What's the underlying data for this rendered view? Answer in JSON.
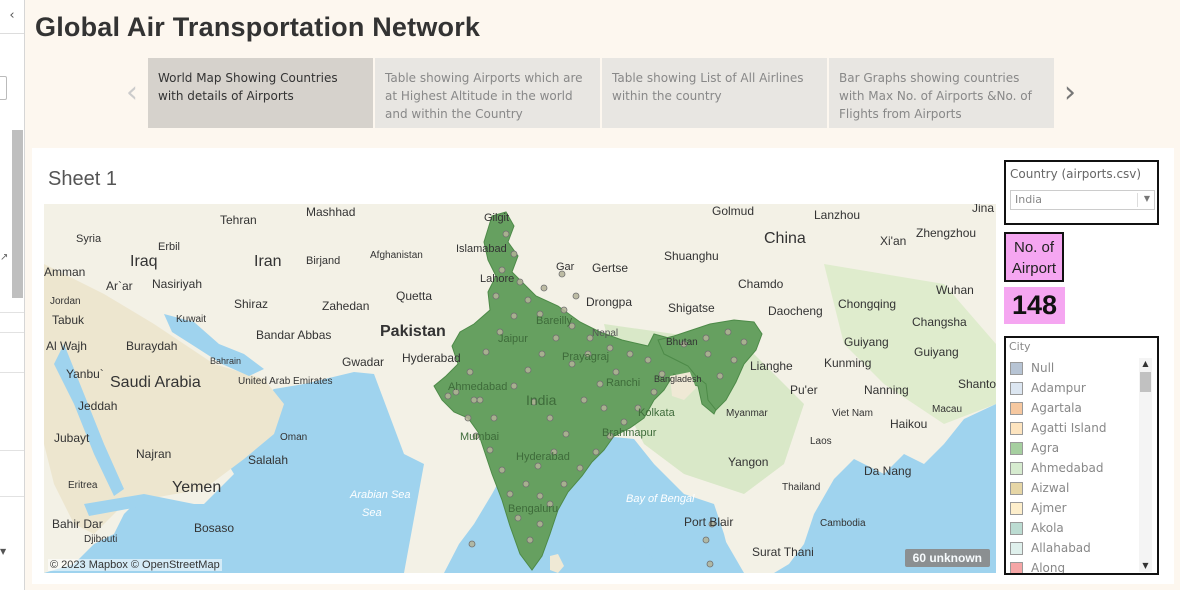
{
  "dashboard": {
    "title": "Global Air Transportation Network"
  },
  "story_points": [
    {
      "label": "World Map Showing Countries with details of Airports",
      "active": true
    },
    {
      "label": "Table showing Airports which are at Highest Altitude in the world and within the Country",
      "active": false
    },
    {
      "label": "Table showing List of All Airlines within the country",
      "active": false
    },
    {
      "label": "Bar Graphs showing countries with Max No. of Airports &No. of Flights from Airports",
      "active": false
    }
  ],
  "sheet": {
    "title": "Sheet 1"
  },
  "map": {
    "attribution": "© 2023 Mapbox © OpenStreetMap",
    "unknown_badge": "60 unknown",
    "highlight_country": "India",
    "highlight_color": "#66a060",
    "water_color": "#9fd3ee",
    "labels": {
      "country": [
        "Iraq",
        "Iran",
        "Pakistan",
        "Saudi Arabia",
        "Yemen",
        "India",
        "China"
      ],
      "city": [
        "Tehran",
        "Mashhad",
        "Syria",
        "Erbil",
        "Birjand",
        "Afghanistan",
        "Islamabad",
        "Gilgit",
        "Golmud",
        "Lanzhou",
        "Xi'an",
        "Zhengzhou",
        "Jina",
        "Amman",
        "Ar`ar",
        "Nasiriyah",
        "Quetta",
        "Lahore",
        "Gar",
        "Gertse",
        "Shuanghu",
        "Chamdo",
        "Wuhan",
        "Jordan",
        "Shiraz",
        "Zahedan",
        "Drongpa",
        "Shigatse",
        "Daocheng",
        "Chongqing",
        "Tabuk",
        "Kuwait",
        "Bandar Abbas",
        "Nepal",
        "Changsha",
        "Al Wajh",
        "Buraydah",
        "Hyderabad",
        "Jaipur",
        "Bhutan",
        "Guiyang",
        "Bahrain",
        "Gwadar",
        "Bareilly",
        "Prayagraj",
        "Kunming",
        "Guiyang",
        "Yanbu`",
        "United Arab Emirates",
        "Ahmedabad",
        "Ranchi",
        "Bangladesh",
        "Lianghe",
        "Pu'er",
        "Nanning",
        "Shanto",
        "Jeddah",
        "Kolkata",
        "Myanmar",
        "Viet Nam",
        "Macau",
        "Oman",
        "Mumbai",
        "Brahmapur",
        "Laos",
        "Haikou",
        "Jubayt",
        "Najran",
        "Salalah",
        "Hyderabad",
        "Yangon",
        "Da Nang",
        "Eritrea",
        "Arabian Sea",
        "Bay of Bengal",
        "Thailand",
        "Bahir Dar",
        "Bosaso",
        "Bengaluru",
        "Port Blair",
        "Cambodia",
        "Djibouti",
        "Surat Thani",
        "Sea"
      ]
    }
  },
  "filters": {
    "country": {
      "label": "Country (airports.csv)",
      "value": "India"
    }
  },
  "kpi": {
    "label": "No. of Airport",
    "value": "148",
    "background": "#f5a6f1"
  },
  "city_legend": {
    "label": "City",
    "items": [
      {
        "name": "Null",
        "color": "#b7c4d4"
      },
      {
        "name": "Adampur",
        "color": "#dce6f1"
      },
      {
        "name": "Agartala",
        "color": "#f6c8a0"
      },
      {
        "name": "Agatti Island",
        "color": "#fde4bf"
      },
      {
        "name": "Agra",
        "color": "#a6cfa0"
      },
      {
        "name": "Ahmedabad",
        "color": "#d6ebcf"
      },
      {
        "name": "Aizwal",
        "color": "#e6d6a6"
      },
      {
        "name": "Ajmer",
        "color": "#fdeecb"
      },
      {
        "name": "Akola",
        "color": "#bcdcd2"
      },
      {
        "name": "Allahabad",
        "color": "#dff0ec"
      },
      {
        "name": "Along",
        "color": "#f5a6a6"
      }
    ]
  }
}
